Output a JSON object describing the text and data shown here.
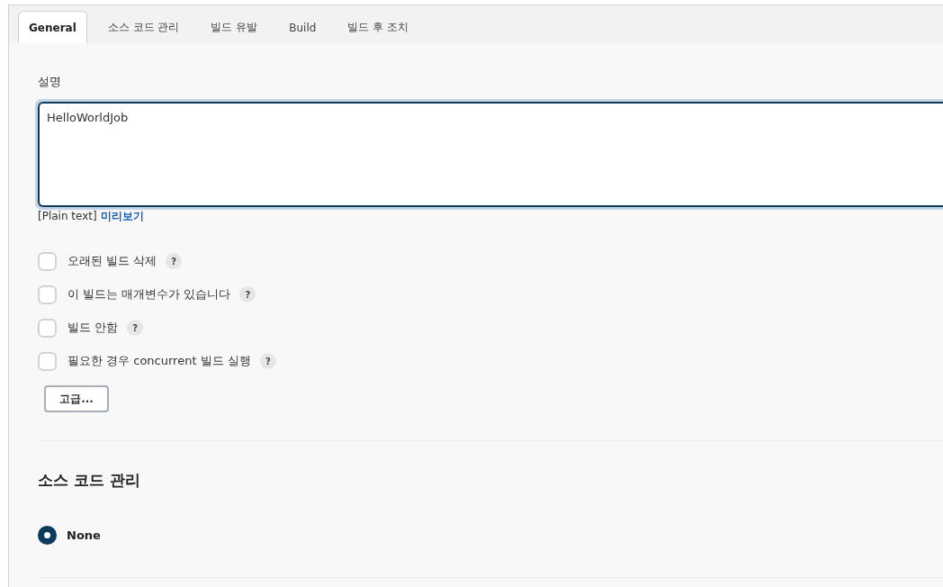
{
  "tabs": [
    {
      "label": "General",
      "selected": true
    },
    {
      "label": "소스 코드 관리",
      "selected": false
    },
    {
      "label": "빌드 유발",
      "selected": false
    },
    {
      "label": "Build",
      "selected": false
    },
    {
      "label": "빌드 후 조치",
      "selected": false
    }
  ],
  "description": {
    "label": "설명",
    "value": "HelloWorldJob",
    "focused": true,
    "format": "[Plain text]",
    "preview_link": "미리보기"
  },
  "options": [
    {
      "label": "오래된 빌드 삭제",
      "checked": false,
      "help": "?"
    },
    {
      "label": "이 빌드는 매개변수가 있습니다",
      "checked": false,
      "help": "?"
    },
    {
      "label": "빌드 안함",
      "checked": false,
      "help": "?"
    },
    {
      "label": "필요한 경우 concurrent 빌드 실행",
      "checked": false,
      "help": "?"
    }
  ],
  "advanced_button": "고급...",
  "scm": {
    "heading": "소스 코드 관리",
    "options": [
      {
        "label": "None",
        "selected": true
      }
    ]
  }
}
